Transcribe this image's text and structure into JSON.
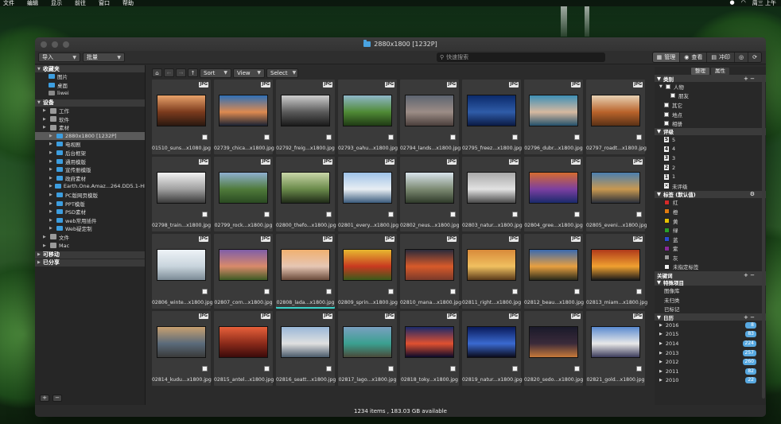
{
  "menubar": {
    "items": [
      "文件",
      "编辑",
      "显示",
      "前往",
      "窗口",
      "帮助"
    ],
    "clock": "周三 上午"
  },
  "window": {
    "title": "2880x1800 [1232P]",
    "status": "1234 items , 183.03 GB available"
  },
  "toolbar": {
    "import_label": "导入",
    "batch_label": "批量",
    "search_placeholder": "快速搜索",
    "view_modes": [
      {
        "label": "管理",
        "icon": "grid-icon"
      },
      {
        "label": "查看",
        "icon": "eye-icon"
      },
      {
        "label": "冲印",
        "icon": "film-icon"
      },
      {
        "label": "",
        "icon": "circle-360-icon"
      },
      {
        "label": "",
        "icon": "rotate-icon"
      }
    ]
  },
  "sidebar": {
    "favorites": {
      "header": "收藏夹",
      "items": [
        "图片",
        "桌面",
        "liwei"
      ]
    },
    "devices": {
      "header": "设备",
      "items": [
        {
          "label": "工作",
          "level": 1,
          "icon": "disk"
        },
        {
          "label": "软件",
          "level": 1,
          "icon": "disk"
        },
        {
          "label": "素材",
          "level": 1,
          "icon": "disk"
        },
        {
          "label": "2880x1800 [1232P]",
          "level": 2,
          "icon": "folder",
          "selected": true
        },
        {
          "label": "电视剧",
          "level": 2,
          "icon": "folder"
        },
        {
          "label": "后台框架",
          "level": 2,
          "icon": "folder"
        },
        {
          "label": "通用模版",
          "level": 2,
          "icon": "folder"
        },
        {
          "label": "宣传册模版",
          "level": 2,
          "icon": "folder"
        },
        {
          "label": "政府素材",
          "level": 2,
          "icon": "folder"
        },
        {
          "label": "Earth.One.Amaz...264.DD5.1-HDC",
          "level": 2,
          "icon": "folder"
        },
        {
          "label": "PC版网页模版",
          "level": 2,
          "icon": "folder"
        },
        {
          "label": "PPT模版",
          "level": 2,
          "icon": "folder"
        },
        {
          "label": "PSD素材",
          "level": 2,
          "icon": "folder"
        },
        {
          "label": "web常用插件",
          "level": 2,
          "icon": "folder"
        },
        {
          "label": "Web疑定制",
          "level": 2,
          "icon": "folder"
        },
        {
          "label": "文件",
          "level": 1,
          "icon": "disk"
        },
        {
          "label": "Mac",
          "level": 1,
          "icon": "disk"
        }
      ]
    },
    "removable": {
      "header": "可移动"
    },
    "shared": {
      "header": "已分享"
    }
  },
  "nav": {
    "sort_label": "Sort",
    "view_label": "View",
    "select_label": "Select"
  },
  "thumbnails": [
    {
      "name": "01510_suns...x1080.jpg",
      "badge": "JPG",
      "colors": [
        "#e9a36a",
        "#7b3a1d",
        "#2a1810"
      ]
    },
    {
      "name": "02739_chica...x1800.jpg",
      "badge": "JPG",
      "colors": [
        "#2f6fb5",
        "#dd8a50",
        "#1a2233"
      ]
    },
    {
      "name": "02792_freig...x1800.jpg",
      "badge": "JPG",
      "colors": [
        "#cfcfcf",
        "#5a5a5a",
        "#1a1a1a"
      ]
    },
    {
      "name": "02793_oahu...x1800.jpg",
      "badge": "JPG",
      "colors": [
        "#8fb7c9",
        "#4f8a35",
        "#1f3a14"
      ]
    },
    {
      "name": "02794_lands...x1800.jpg",
      "badge": "JPG",
      "colors": [
        "#5d6470",
        "#9c8d86",
        "#4b3f3c"
      ]
    },
    {
      "name": "02795_freez...x1800.jpg",
      "badge": "JPG",
      "colors": [
        "#0b2a6b",
        "#2f5ca8",
        "#0a1a44"
      ]
    },
    {
      "name": "02796_dubr...x1800.jpg",
      "badge": "JPG",
      "colors": [
        "#3e8fb6",
        "#d6b9a0",
        "#23506a"
      ]
    },
    {
      "name": "02797_roadt...x1800.jpg",
      "badge": "JPG",
      "colors": [
        "#e8d2b4",
        "#b9632b",
        "#5a3116"
      ]
    },
    {
      "name": "02798_train...x1800.jpg",
      "badge": "JPG",
      "colors": [
        "#f2f2f2",
        "#a0a0a0",
        "#3a3a3a"
      ]
    },
    {
      "name": "02799_rock...x1800.jpg",
      "badge": "JPG",
      "colors": [
        "#8fb0d0",
        "#4f7a3a",
        "#2a4a22"
      ]
    },
    {
      "name": "02800_thefo...x1800.jpg",
      "badge": "JPG",
      "colors": [
        "#c9d6a8",
        "#6a8a4a",
        "#1f2a18"
      ]
    },
    {
      "name": "02801_every...x1800.jpg",
      "badge": "JPG",
      "colors": [
        "#9fc3e8",
        "#e8eef3",
        "#3a5b7c"
      ]
    },
    {
      "name": "02802_neus...x1800.jpg",
      "badge": "JPG",
      "colors": [
        "#d9e4ec",
        "#7c8a72",
        "#2f3a2a"
      ]
    },
    {
      "name": "02803_natur...x1800.jpg",
      "badge": "JPG",
      "colors": [
        "#a9a9a9",
        "#e2e2e2",
        "#4a4a4a"
      ]
    },
    {
      "name": "02804_gree...x1800.jpg",
      "badge": "JPG",
      "colors": [
        "#d56b2f",
        "#7b3fa1",
        "#1a2a6b"
      ]
    },
    {
      "name": "02805_eveni...x1800.jpg",
      "badge": "JPG",
      "colors": [
        "#4b7fb0",
        "#c89850",
        "#2a2f3a"
      ]
    },
    {
      "name": "02806_winte...x1800.jpg",
      "badge": "JPG",
      "colors": [
        "#eef3f7",
        "#c8d4dc",
        "#7b8a95"
      ]
    },
    {
      "name": "02807_corn...x1800.jpg",
      "badge": "JPG",
      "colors": [
        "#7f5ea8",
        "#d98a6a",
        "#3d5a24"
      ]
    },
    {
      "name": "02808_lada...x1800.jpg",
      "badge": "JPG",
      "colors": [
        "#f0b070",
        "#e6c6b4",
        "#6a4a3a"
      ],
      "highlight": true
    },
    {
      "name": "02809_sprin...x1800.jpg",
      "badge": "JPG",
      "colors": [
        "#e8b830",
        "#c83a20",
        "#3a5a1a"
      ]
    },
    {
      "name": "02810_mana...x1800.jpg",
      "badge": "JPG",
      "colors": [
        "#2b2b3b",
        "#d85a2a",
        "#7a3a2a"
      ]
    },
    {
      "name": "02811_right...x1800.jpg",
      "badge": "JPG",
      "colors": [
        "#d88a3a",
        "#f0c060",
        "#5a3a1a"
      ]
    },
    {
      "name": "02812_beau...x1800.jpg",
      "badge": "JPG",
      "colors": [
        "#3a6ab0",
        "#e8a040",
        "#2a2a1a"
      ]
    },
    {
      "name": "02813_miam...x1800.jpg",
      "badge": "JPG",
      "colors": [
        "#b03a1a",
        "#f0a030",
        "#1a1a1a"
      ]
    },
    {
      "name": "02814_kudu...x1800.jpg",
      "badge": "JPG",
      "colors": [
        "#c8a070",
        "#5a6a7a",
        "#3a3a3a"
      ]
    },
    {
      "name": "02815_antel...x1800.jpg",
      "badge": "JPG",
      "colors": [
        "#e8603a",
        "#8a2a1a",
        "#3a0a0a"
      ]
    },
    {
      "name": "02816_seatt...x1800.jpg",
      "badge": "JPG",
      "colors": [
        "#9ab8d8",
        "#e0e0e0",
        "#4a5a6a"
      ]
    },
    {
      "name": "02817_lago...x1800.jpg",
      "badge": "JPG",
      "colors": [
        "#7aa0c0",
        "#3aa090",
        "#4a4a3a"
      ]
    },
    {
      "name": "02818_toky...x1800.jpg",
      "badge": "JPG",
      "colors": [
        "#1a2a6a",
        "#e05030",
        "#0a0a2a"
      ]
    },
    {
      "name": "02819_natur...x1800.jpg",
      "badge": "JPG",
      "colors": [
        "#0a1a5a",
        "#3a6ad0",
        "#0a0a1a"
      ]
    },
    {
      "name": "02820_sedo...x1800.jpg",
      "badge": "JPG",
      "colors": [
        "#1a1a2a",
        "#3a2a3a",
        "#c87a3a"
      ]
    },
    {
      "name": "02821_gold...x1800.jpg",
      "badge": "JPG",
      "colors": [
        "#5a8ad0",
        "#e8e8e8",
        "#3a3a5a"
      ]
    }
  ],
  "right_panel": {
    "tabs": [
      "整理",
      "属性"
    ],
    "category": {
      "header": "类别",
      "items": [
        {
          "label": "人物",
          "indent": 0,
          "tri": true
        },
        {
          "label": "朋友",
          "indent": 1
        },
        {
          "label": "其它",
          "indent": 0
        },
        {
          "label": "地点",
          "indent": 0
        },
        {
          "label": "相册",
          "indent": 0
        }
      ]
    },
    "rating": {
      "header": "评级",
      "items": [
        "5",
        "4",
        "3",
        "2",
        "1",
        "未评级"
      ]
    },
    "labels": {
      "header": "标签 (默认值)",
      "items": [
        {
          "label": "红",
          "color": "#d42a2a"
        },
        {
          "label": "橙",
          "color": "#e07a10"
        },
        {
          "label": "黄",
          "color": "#e6c000"
        },
        {
          "label": "绿",
          "color": "#2aa02a"
        },
        {
          "label": "蓝",
          "color": "#2a4ad0"
        },
        {
          "label": "紫",
          "color": "#8a2a9a"
        },
        {
          "label": "灰",
          "color": "#9a9a9a"
        },
        {
          "label": "未指定标签",
          "color": "#f0f0f0"
        }
      ]
    },
    "keywords": {
      "header": "关键词"
    },
    "special": {
      "header": "特殊项目",
      "items": [
        "图像库",
        "未归类",
        "已标记"
      ]
    },
    "calendar": {
      "header": "日历",
      "years": [
        {
          "year": "2016",
          "count": "8"
        },
        {
          "year": "2015",
          "count": "83"
        },
        {
          "year": "2014",
          "count": "224"
        },
        {
          "year": "2013",
          "count": "257"
        },
        {
          "year": "2012",
          "count": "260"
        },
        {
          "year": "2011",
          "count": "82"
        },
        {
          "year": "2010",
          "count": "22"
        }
      ]
    }
  }
}
